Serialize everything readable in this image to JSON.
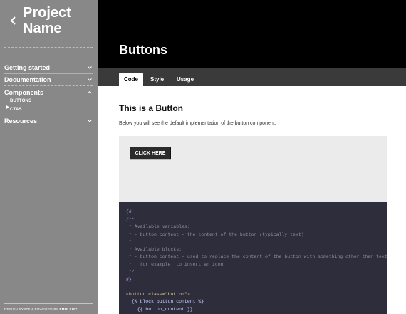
{
  "sidebar": {
    "project_name_line1": "Project",
    "project_name_line2": "Name",
    "nav": [
      {
        "label": "Getting started",
        "expanded": false
      },
      {
        "label": "Documentation",
        "expanded": false
      },
      {
        "label": "Components",
        "expanded": true
      },
      {
        "label": "Resources",
        "expanded": false
      }
    ],
    "sub_items": [
      "BUTTONS",
      "CTAS"
    ],
    "footer_prefix": "DESIGN SYSTEM POWERED BY",
    "footer_brand": "EMULSIFY"
  },
  "header": {
    "title": "Buttons"
  },
  "tabs": [
    {
      "label": "Code",
      "active": true
    },
    {
      "label": "Style",
      "active": false
    },
    {
      "label": "Usage",
      "active": false
    }
  ],
  "main": {
    "section_title": "This is a Button",
    "section_desc": "Below you will see the default implementation of the button component.",
    "demo_button_label": "CLICK HERE"
  },
  "code": {
    "lines": [
      "{#",
      "/**",
      " * Available variables:",
      " * - button_content - the content of the button (typically text)",
      " *",
      " * Available blocks:",
      " * - button_content - used to replace the content of the button with something other than text",
      " *   for example: to insert an icon",
      " */",
      "#}",
      "",
      "<button class=\"button\">",
      "  {% block button_content %}",
      "    {{ button_content }}"
    ]
  },
  "colors": {
    "sidebar_bg": "#888888",
    "header_bg": "#000000",
    "tabbar_bg": "#3a3a3a",
    "demo_bg": "#ebebeb",
    "code_bg": "#2d2d3b",
    "button_bg": "#2b2b2b"
  }
}
